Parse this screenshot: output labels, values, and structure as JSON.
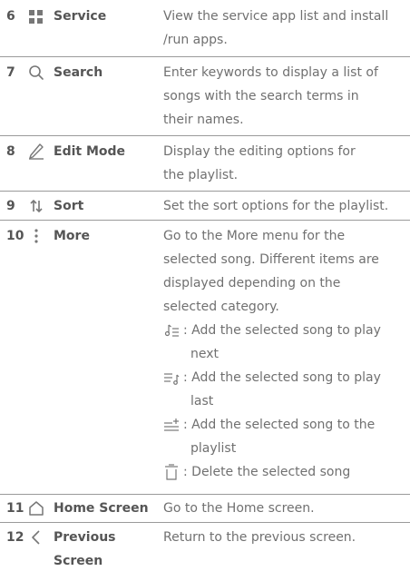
{
  "rows": [
    {
      "num": "6",
      "name": "Service",
      "icon": "grid-icon",
      "desc": [
        "View the service app list and install",
        "/run apps."
      ]
    },
    {
      "num": "7",
      "name": "Search",
      "icon": "search-icon",
      "desc": [
        "Enter keywords to display a list of",
        "songs with the search terms in",
        "their names."
      ]
    },
    {
      "num": "8",
      "name": "Edit Mode",
      "icon": "pencil-icon",
      "desc": [
        "Display the editing options for",
        "the playlist."
      ]
    },
    {
      "num": "9",
      "name": "Sort",
      "icon": "sort-icon",
      "desc": [
        "Set the sort options for the playlist."
      ]
    },
    {
      "num": "10",
      "name": "More",
      "icon": "more-vertical-icon",
      "desc": [
        "Go to the More menu for the",
        "selected song. Different items are",
        "displayed depending on the",
        "selected category."
      ],
      "options": [
        {
          "icon": "play-next-icon",
          "line1": ": Add the selected song to play",
          "line2": "next"
        },
        {
          "icon": "play-last-icon",
          "line1": ": Add the selected song to play",
          "line2": "last"
        },
        {
          "icon": "add-to-playlist-icon",
          "line1": ": Add the selected song to the",
          "line2": "playlist"
        },
        {
          "icon": "delete-icon",
          "line1": ": Delete the selected song"
        }
      ]
    },
    {
      "num": "11",
      "name": "Home Screen",
      "icon": "home-icon",
      "desc": [
        "Go to the Home screen."
      ]
    },
    {
      "num": "12",
      "name": "Previous",
      "name2": "Screen",
      "icon": "back-arrow-icon",
      "desc": [
        "Return to the previous screen."
      ]
    }
  ]
}
